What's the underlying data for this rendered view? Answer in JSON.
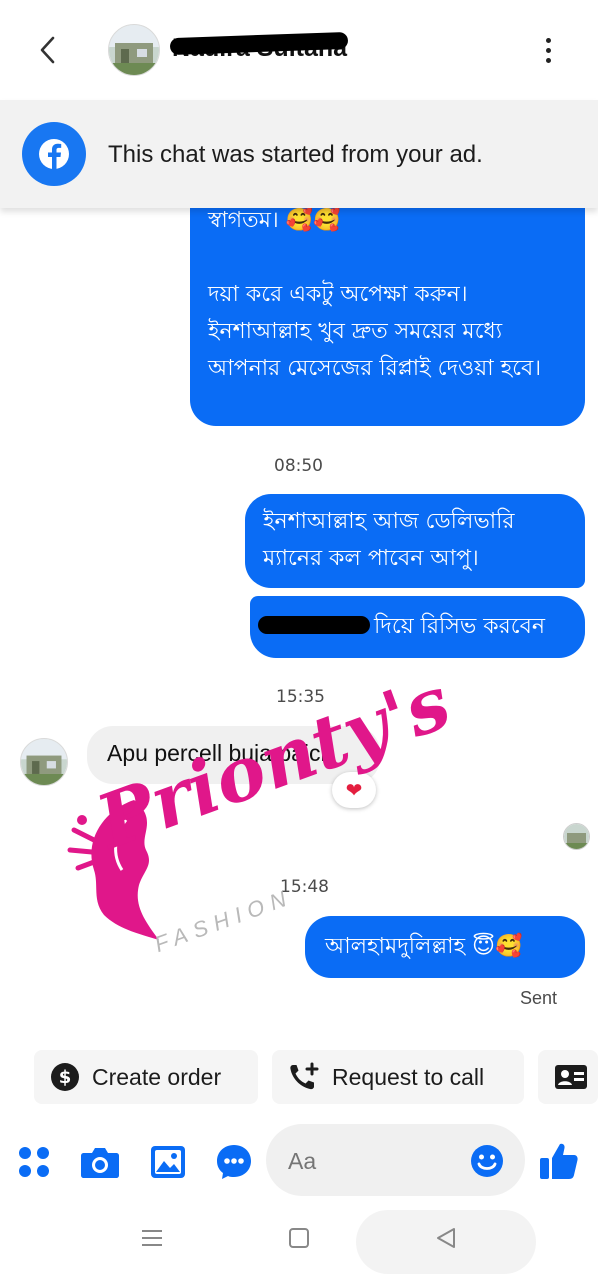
{
  "header": {
    "contact_name": "Nadira Sultana",
    "back_icon": "chevron-left-icon",
    "menu_icon": "more-vertical-icon"
  },
  "ad_banner": {
    "text": "This chat was started from your ad.",
    "icon": "facebook-icon",
    "color": "#1877f2"
  },
  "messages": [
    {
      "type": "outgoing",
      "text": "স্বাগতম। 🥰🥰\n\nদয়া করে একটু অপেক্ষা করুন। ইনশাআল্লাহ খুব দ্রুত সময়ের মধ্যে আপনার মেসেজের রিপ্লাই দেওয়া হবে।"
    },
    {
      "type": "timestamp",
      "text": "08:50"
    },
    {
      "type": "outgoing",
      "text": "ইনশাআল্লাহ আজ ডেলিভারি ম্যানের  কল পাবেন আপু।"
    },
    {
      "type": "outgoing",
      "text": "দিয়ে রিসিভ করবেন"
    },
    {
      "type": "timestamp",
      "text": "15:35"
    },
    {
      "type": "incoming",
      "text": "Apu percell buja paici",
      "reaction": "❤"
    },
    {
      "type": "timestamp",
      "text": "15:48"
    },
    {
      "type": "outgoing",
      "text": "আলহামদুলিল্লাহ 😇🥰"
    }
  ],
  "status": {
    "sent_label": "Sent"
  },
  "watermark": {
    "brand": "Prionty's",
    "sub": "FASHION"
  },
  "quick_actions": [
    {
      "label": "Create order",
      "icon": "dollar-icon"
    },
    {
      "label": "Request to call",
      "icon": "phone-add-icon"
    },
    {
      "label": "",
      "icon": "contact-card-icon"
    }
  ],
  "composer": {
    "placeholder": "Aa",
    "icons": [
      "apps-icon",
      "camera-icon",
      "gallery-icon",
      "chat-bubble-icon",
      "emoji-icon",
      "thumbs-up-icon"
    ]
  },
  "colors": {
    "accent": "#0a6cf5",
    "incoming_bubble": "#f0f0f0",
    "watermark_pink": "#e0178a"
  }
}
